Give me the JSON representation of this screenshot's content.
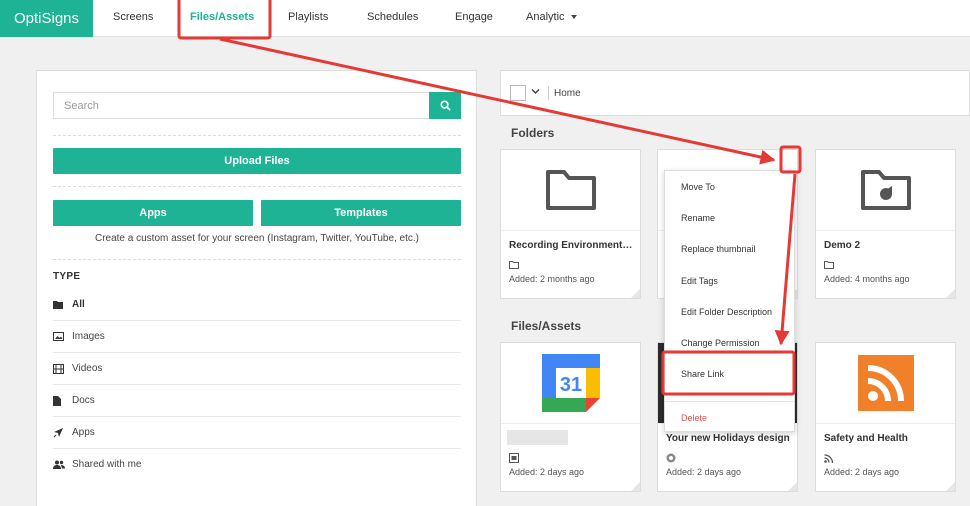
{
  "nav": {
    "brand": "OptiSigns",
    "items": [
      {
        "label": "Screens"
      },
      {
        "label": "Files/Assets"
      },
      {
        "label": "Playlists"
      },
      {
        "label": "Schedules"
      },
      {
        "label": "Engage"
      },
      {
        "label": "Analytic"
      }
    ]
  },
  "sidebar": {
    "search_placeholder": "Search",
    "upload_label": "Upload Files",
    "apps_label": "Apps",
    "templates_label": "Templates",
    "hint": "Create a custom asset for your screen (Instagram, Twitter, YouTube, etc.)",
    "type_heading": "TYPE",
    "types": [
      {
        "label": "All"
      },
      {
        "label": "Images"
      },
      {
        "label": "Videos"
      },
      {
        "label": "Docs"
      },
      {
        "label": "Apps"
      },
      {
        "label": "Shared with me"
      }
    ]
  },
  "breadcrumb": {
    "home": "Home"
  },
  "folders": {
    "heading": "Folders",
    "items": [
      {
        "title": "Recording Environment ...",
        "date": "Added: 2 months ago"
      },
      {
        "title": "",
        "date": ""
      },
      {
        "title": "Demo 2",
        "date": "Added: 4 months ago"
      }
    ]
  },
  "files": {
    "heading": "Files/Assets",
    "items": [
      {
        "title": "",
        "date": "Added: 2 days ago",
        "calendar_day": "31"
      },
      {
        "title": "Your new Holidays design",
        "date": "Added: 2 days ago"
      },
      {
        "title": "Safety and Health",
        "date": "Added: 2 days ago"
      }
    ]
  },
  "context_menu": {
    "items": [
      {
        "label": "Move To"
      },
      {
        "label": "Rename"
      },
      {
        "label": "Replace thumbnail"
      },
      {
        "label": "Edit Tags"
      },
      {
        "label": "Edit Folder Description"
      },
      {
        "label": "Change Permission"
      },
      {
        "label": "Share Link"
      },
      {
        "label": "Delete"
      }
    ]
  },
  "colors": {
    "accent": "#1db394",
    "annotation": "#e53935",
    "rss": "#f0812a",
    "danger": "#d9534f"
  }
}
